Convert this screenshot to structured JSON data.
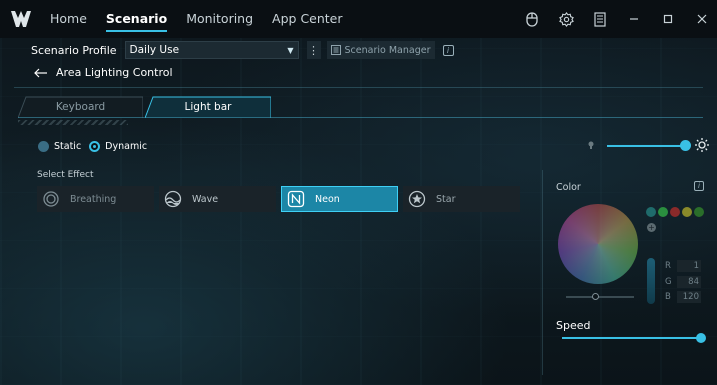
{
  "nav": {
    "tabs": [
      {
        "label": "Home"
      },
      {
        "label": "Scenario"
      },
      {
        "label": "Monitoring"
      },
      {
        "label": "App Center"
      }
    ],
    "active_tab": "Scenario"
  },
  "profile": {
    "label": "Scenario Profile",
    "selected": "Daily Use",
    "manager_label": "Scenario Manager"
  },
  "back": {
    "title": "Area Lighting Control"
  },
  "subtabs": {
    "keyboard": "Keyboard",
    "lightbar": "Light bar",
    "active": "Light bar"
  },
  "mode": {
    "static_label": "Static",
    "dynamic_label": "Dynamic",
    "selected": "Dynamic"
  },
  "brightness": {
    "level": 1.0
  },
  "effects": {
    "label": "Select Effect",
    "items": [
      {
        "label": "Breathing",
        "icon": "breathing-icon"
      },
      {
        "label": "Wave",
        "icon": "wave-icon"
      },
      {
        "label": "Neon",
        "icon": "neon-icon"
      },
      {
        "label": "Star",
        "icon": "star-icon"
      }
    ],
    "selected": "Neon"
  },
  "color_panel": {
    "label": "Color",
    "swatches": [
      "#1f6b6b",
      "#2a8f3f",
      "#8a2a2a",
      "#8a8a2a",
      "#2a6e2a"
    ],
    "r_label": "R",
    "g_label": "G",
    "b_label": "B",
    "r": "1",
    "g": "84",
    "b": "120"
  },
  "speed": {
    "label": "Speed",
    "level": 1.0
  },
  "colors": {
    "accent": "#39c0e5",
    "active_effect_bg": "#1c86a6",
    "topbar_bg": "#0a0f13"
  }
}
